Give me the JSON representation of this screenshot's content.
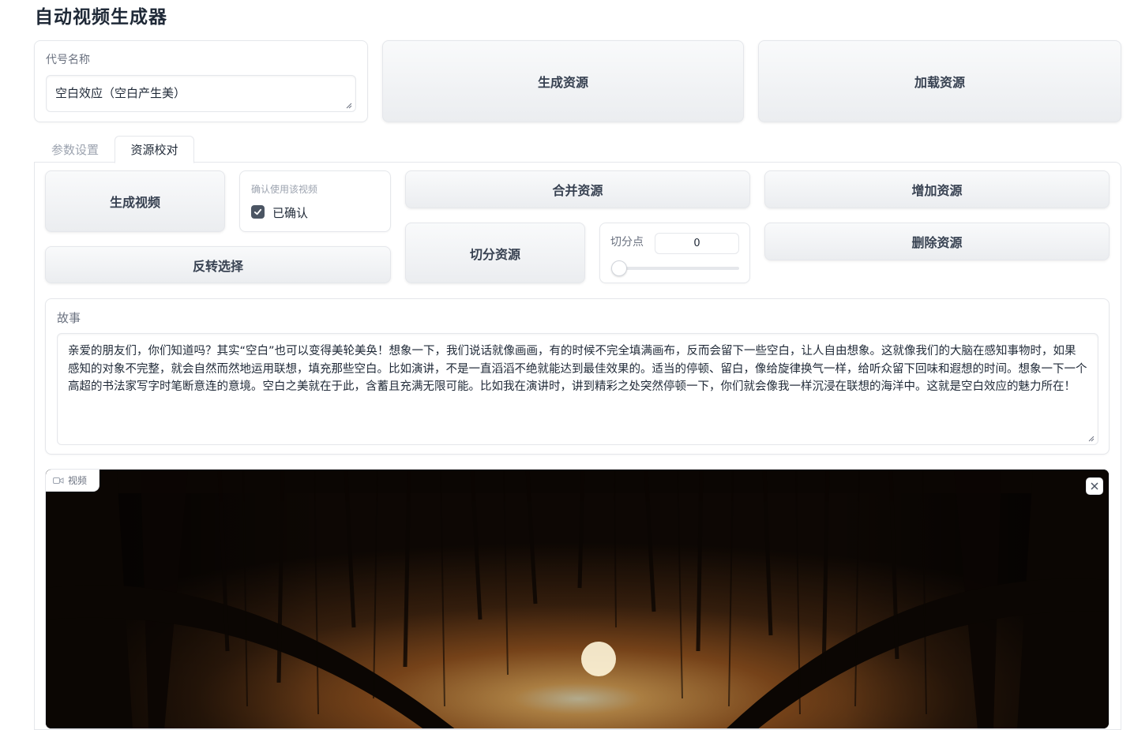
{
  "app": {
    "title": "自动视频生成器"
  },
  "code_name": {
    "label": "代号名称",
    "value": "空白效应（空白产生美）"
  },
  "top_buttons": {
    "generate_resources": "生成资源",
    "load_resources": "加载资源"
  },
  "tabs": [
    {
      "label": "参数设置",
      "active": false
    },
    {
      "label": "资源校对",
      "active": true
    }
  ],
  "review": {
    "generate_video": "生成视频",
    "confirm": {
      "label": "确认使用该视频",
      "checked": true,
      "checkbox_label": "已确认"
    },
    "invert_selection": "反转选择",
    "merge_resources": "合并资源",
    "add_resources": "增加资源",
    "split_resources": "切分资源",
    "split_point": {
      "label": "切分点",
      "value": "0",
      "slider_fraction": 0
    },
    "delete_resources": "删除资源"
  },
  "story": {
    "label": "故事",
    "text": "亲爱的朋友们，你们知道吗？其实“空白”也可以变得美轮美奂！想象一下，我们说话就像画画，有的时候不完全填满画布，反而会留下一些空白，让人自由想象。这就像我们的大脑在感知事物时，如果感知的对象不完整，就会自然而然地运用联想，填充那些空白。比如演讲，不是一直滔滔不绝就能达到最佳效果的。适当的停顿、留白，像给旋律换气一样，给听众留下回味和遐想的时间。想象一下一个高超的书法家写字时笔断意连的意境。空白之美就在于此，含蓄且充满无限可能。比如我在演讲时，讲到精彩之处突然停顿一下，你们就会像我一样沉浸在联想的海洋中。这就是空白效应的魅力所在！"
  },
  "video": {
    "label": "视频",
    "icon": "video-camera-icon",
    "close_icon": "close-icon"
  },
  "colors": {
    "button_bg": "#eef0f2",
    "border": "#e5e7eb",
    "checkbox": "#4b5563"
  }
}
